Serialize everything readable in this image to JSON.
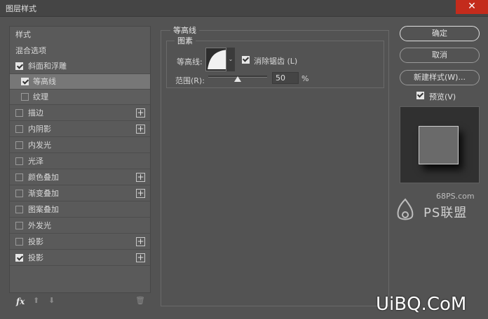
{
  "window": {
    "title": "图层样式",
    "close_glyph": "✕"
  },
  "left_panel": {
    "header_styles": "样式",
    "header_blend": "混合选项",
    "items": [
      {
        "label": "斜面和浮雕",
        "checked": true
      },
      {
        "label": "等高线",
        "checked": true
      },
      {
        "label": "纹理",
        "checked": false
      },
      {
        "label": "描边",
        "checked": false
      },
      {
        "label": "内阴影",
        "checked": false
      },
      {
        "label": "内发光",
        "checked": false
      },
      {
        "label": "光泽",
        "checked": false
      },
      {
        "label": "颜色叠加",
        "checked": false
      },
      {
        "label": "渐变叠加",
        "checked": false
      },
      {
        "label": "图案叠加",
        "checked": false
      },
      {
        "label": "外发光",
        "checked": false
      },
      {
        "label": "投影",
        "checked": false
      },
      {
        "label": "投影",
        "checked": true
      }
    ],
    "plus_glyph": "+",
    "footer": {
      "fx": "fx",
      "up": "⬆",
      "down": "⬇",
      "trash": "🗑"
    }
  },
  "contour": {
    "section_title": "等高线",
    "group_title": "图素",
    "contour_label": "等高线:",
    "dropdown_glyph": "⌄",
    "anti_alias_label": "消除锯齿 (L)",
    "range_label": "范围(R):",
    "range_value": "50",
    "range_unit": "%",
    "range_fraction": 0.5
  },
  "buttons": {
    "ok": "确定",
    "cancel": "取消",
    "new_style": "新建样式(W)...",
    "preview_label": "预览(V)"
  },
  "watermark": {
    "site": "68PS.com",
    "brand": "PS联盟",
    "bottom": "UiBQ.CoM"
  },
  "colors": {
    "background": "#535353",
    "selected_row": "#777777",
    "close_button": "#c42b1c"
  }
}
